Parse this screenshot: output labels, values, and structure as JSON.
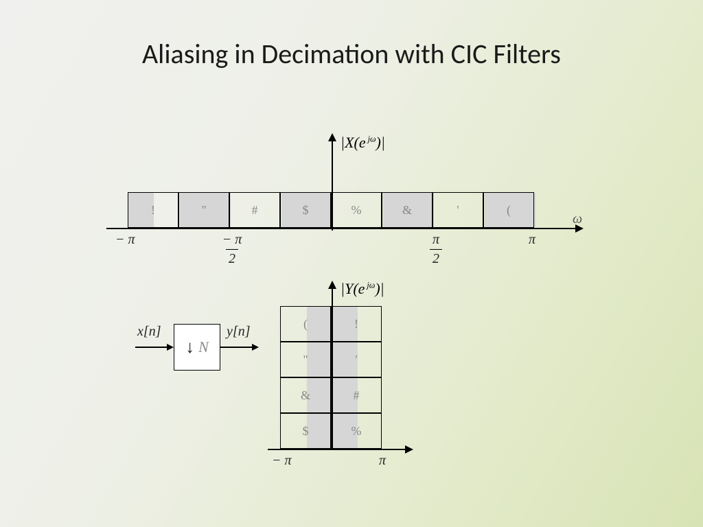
{
  "title": "Aliasing in Decimation with CIC Filters",
  "top_spectrum": {
    "label": "|X(e^{jω})|",
    "axis_var": "ω",
    "cells": [
      "!",
      "\"",
      "#",
      "$",
      "%",
      "&",
      "'",
      "("
    ],
    "ticks": {
      "neg_pi": "−π",
      "neg_pi2": "−π⁄2",
      "pi2": "π⁄2",
      "pi": "π"
    }
  },
  "downsample": {
    "in_label": "x[n]",
    "out_label": "y[n]",
    "factor_symbol": "↓ N"
  },
  "bottom_spectrum": {
    "label": "|Y(e^{jω})|",
    "rows": [
      [
        "(",
        "!"
      ],
      [
        "\"",
        "'"
      ],
      [
        "&",
        "#"
      ],
      [
        "$",
        "%"
      ]
    ],
    "ticks": {
      "neg_pi": "−π",
      "pi": "π"
    }
  }
}
